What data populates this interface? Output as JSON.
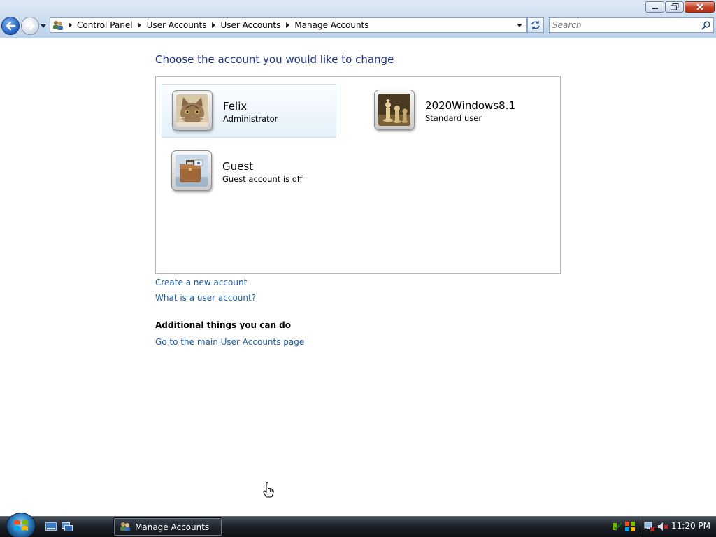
{
  "window": {
    "controls": [
      "minimize",
      "maximize",
      "close"
    ]
  },
  "nav": {
    "back_icon": "back-arrow-icon",
    "forward_icon": "forward-arrow-icon",
    "breadcrumb": [
      "Control Panel",
      "User Accounts",
      "User Accounts",
      "Manage Accounts"
    ],
    "search_placeholder": "Search"
  },
  "content": {
    "title": "Choose the account you would like to change",
    "accounts": [
      {
        "name": "Felix",
        "role": "Administrator",
        "picture": "cat-picture",
        "selected": true
      },
      {
        "name": "2020Windows8.1",
        "role": "Standard user",
        "picture": "chess-picture",
        "selected": false
      },
      {
        "name": "Guest",
        "role": "Guest account is off",
        "picture": "briefcase-picture",
        "selected": false
      }
    ],
    "links": {
      "create": "Create a new account",
      "what_is": "What is a user account?"
    },
    "additional_heading": "Additional things you can do",
    "additional_links": [
      "Go to the main User Accounts page"
    ]
  },
  "taskbar": {
    "task_label": "Manage Accounts",
    "clock": "11:20 PM"
  },
  "colors": {
    "title": "#1e3287",
    "link": "#1d5ea9",
    "selection_bg": "#e4f1fb",
    "selection_border": "#bfe0f5"
  }
}
